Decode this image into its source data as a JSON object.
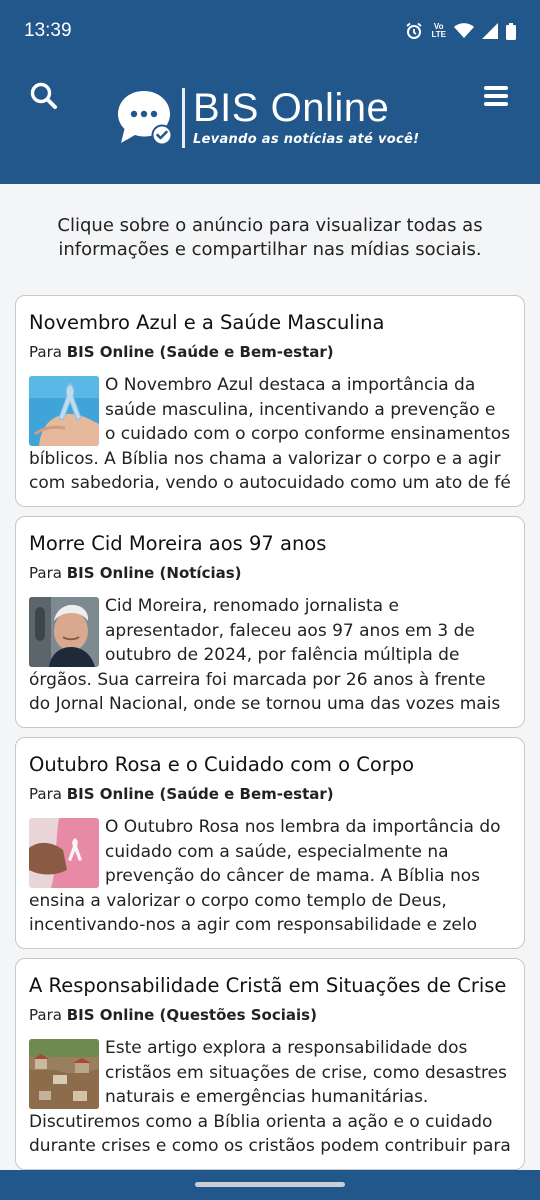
{
  "status": {
    "time": "13:39",
    "volte_top": "Vo",
    "volte_bottom": "LTE",
    "icons": [
      "alarm-icon",
      "volte-icon",
      "wifi-icon",
      "signal-icon",
      "battery-icon"
    ]
  },
  "header": {
    "brand_name": "BIS Online",
    "tagline": "Levando as notícias até você!",
    "icons": [
      "search-icon",
      "menu-icon",
      "chat-logo-icon"
    ],
    "colors": {
      "primary": "#22578b",
      "background": "#f4f5f7"
    }
  },
  "intro": "Clique sobre o anúncio para visualizar todas as informações e compartilhar nas mídias sociais.",
  "articles": [
    {
      "title": "Novembro Azul e a Saúde Masculina",
      "meta_prefix": "Para",
      "source": "BIS Online (Saúde e Bem-estar)",
      "excerpt": "O Novembro Azul destaca a importância da saúde masculina, incentivando a prevenção e o cuidado com o corpo conforme ensinamentos bíblicos. A Bíblia nos chama a valorizar o corpo e a agir com sabedoria, vendo o autocuidado como um ato de fé",
      "thumb": "blue-ribbon-image"
    },
    {
      "title": "Morre Cid Moreira aos 97 anos",
      "meta_prefix": "Para",
      "source": "BIS Online (Notícias)",
      "excerpt": "Cid Moreira, renomado jornalista e apresentador, faleceu aos 97 anos em 3 de outubro de 2024, por falência múltipla de órgãos. Sua carreira foi marcada por 26 anos à frente do Jornal Nacional, onde se tornou uma das vozes mais",
      "thumb": "portrait-image"
    },
    {
      "title": "Outubro Rosa e o Cuidado com o Corpo",
      "meta_prefix": "Para",
      "source": "BIS Online (Saúde e Bem-estar)",
      "excerpt": "O Outubro Rosa nos lembra da importância do cuidado com a saúde, especialmente na prevenção do câncer de mama. A Bíblia nos ensina a valorizar o corpo como templo de Deus, incentivando-nos a agir com responsabilidade e zelo",
      "thumb": "pink-ribbon-image"
    },
    {
      "title": "A Responsabilidade Cristã em Situações de Crise",
      "meta_prefix": "Para",
      "source": "BIS Online (Questões Sociais)",
      "excerpt": "Este artigo explora a responsabilidade dos cristãos em situações de crise, como desastres naturais e emergências humanitárias. Discutiremos como a Bíblia orienta a ação e o cuidado durante crises e como os cristãos podem contribuir para",
      "thumb": "flood-image"
    }
  ]
}
